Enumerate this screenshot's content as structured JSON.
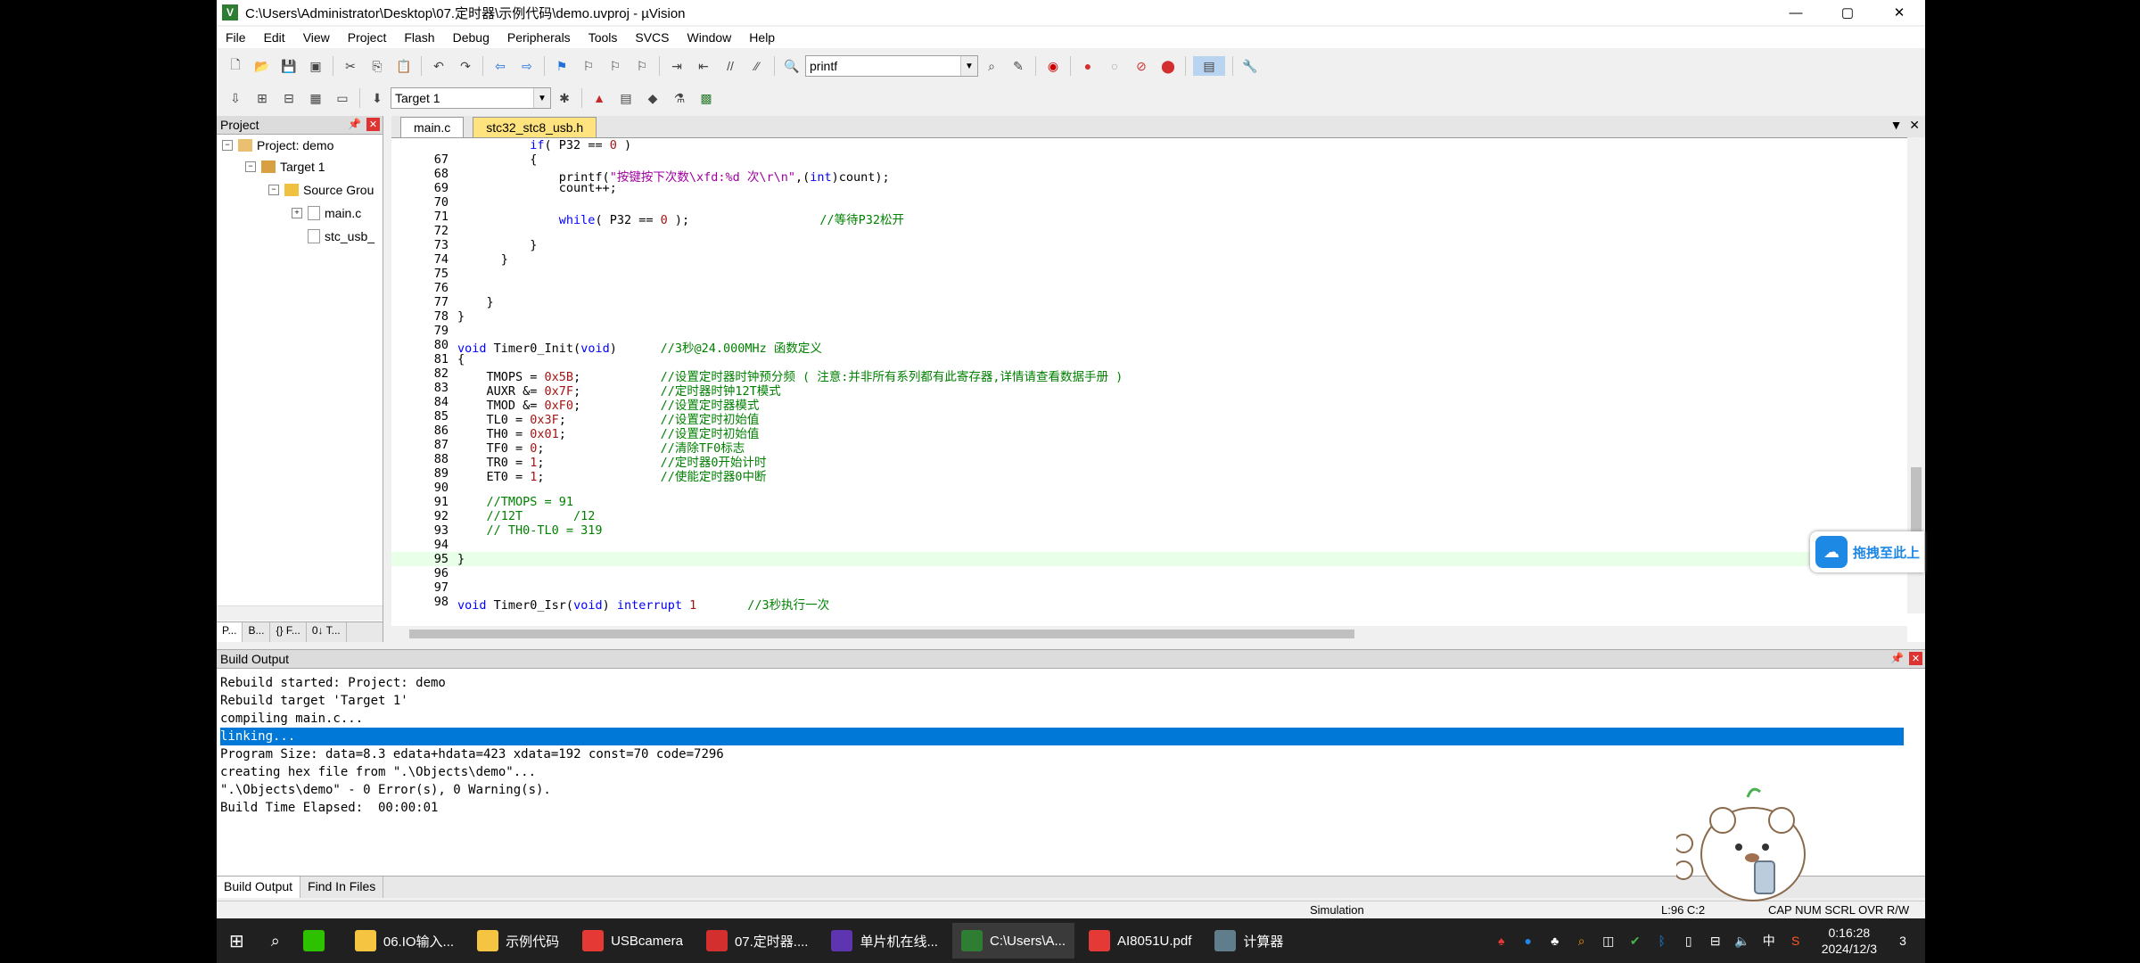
{
  "window": {
    "title": "C:\\Users\\Administrator\\Desktop\\07.定时器\\示例代码\\demo.uvproj - µVision",
    "controls": [
      "—",
      "▢",
      "✕"
    ]
  },
  "menu": [
    "File",
    "Edit",
    "View",
    "Project",
    "Flash",
    "Debug",
    "Peripherals",
    "Tools",
    "SVCS",
    "Window",
    "Help"
  ],
  "toolbar": {
    "find_value": "printf",
    "target_value": "Target 1"
  },
  "project_panel": {
    "title": "Project",
    "tree": {
      "root": "Project: demo",
      "target": "Target 1",
      "group": "Source Grou",
      "file1": "main.c",
      "file2": "stc_usb_"
    },
    "tabs": [
      "P...",
      "B...",
      "{} F...",
      "0↓ T..."
    ]
  },
  "editor": {
    "tabs": [
      "main.c",
      "stc32_stc8_usb.h"
    ]
  },
  "build_output": {
    "title": "Build Output",
    "lines": [
      "Rebuild started: Project: demo",
      "Rebuild target 'Target 1'",
      "compiling main.c...",
      "linking...",
      "Program Size: data=8.3 edata+hdata=423 xdata=192 const=70 code=7296",
      "creating hex file from \".\\Objects\\demo\"...",
      "\".\\Objects\\demo\" - 0 Error(s), 0 Warning(s).",
      "Build Time Elapsed:  00:00:01"
    ],
    "tabs": [
      "Build Output",
      "Find In Files"
    ]
  },
  "status": {
    "mode": "Simulation",
    "position": "L:96 C:2",
    "flags": "CAP NUM SCRL OVR R/W"
  },
  "badge": {
    "text": "拖拽至此上"
  },
  "taskbar": {
    "items": [
      "06.IO输入...",
      "示例代码",
      "USBcamera",
      "07.定时器....",
      "单片机在线...",
      "C:\\Users\\A...",
      "AI8051U.pdf",
      "计算器"
    ],
    "ime": "中",
    "time": "0:16:28",
    "date": "2024/12/3",
    "notif": "3"
  },
  "colors": {
    "keyword": "#0000ff",
    "number": "#a31515",
    "comment": "#008000",
    "selection": "#0078d7",
    "current_line": "#e8ffe8"
  }
}
